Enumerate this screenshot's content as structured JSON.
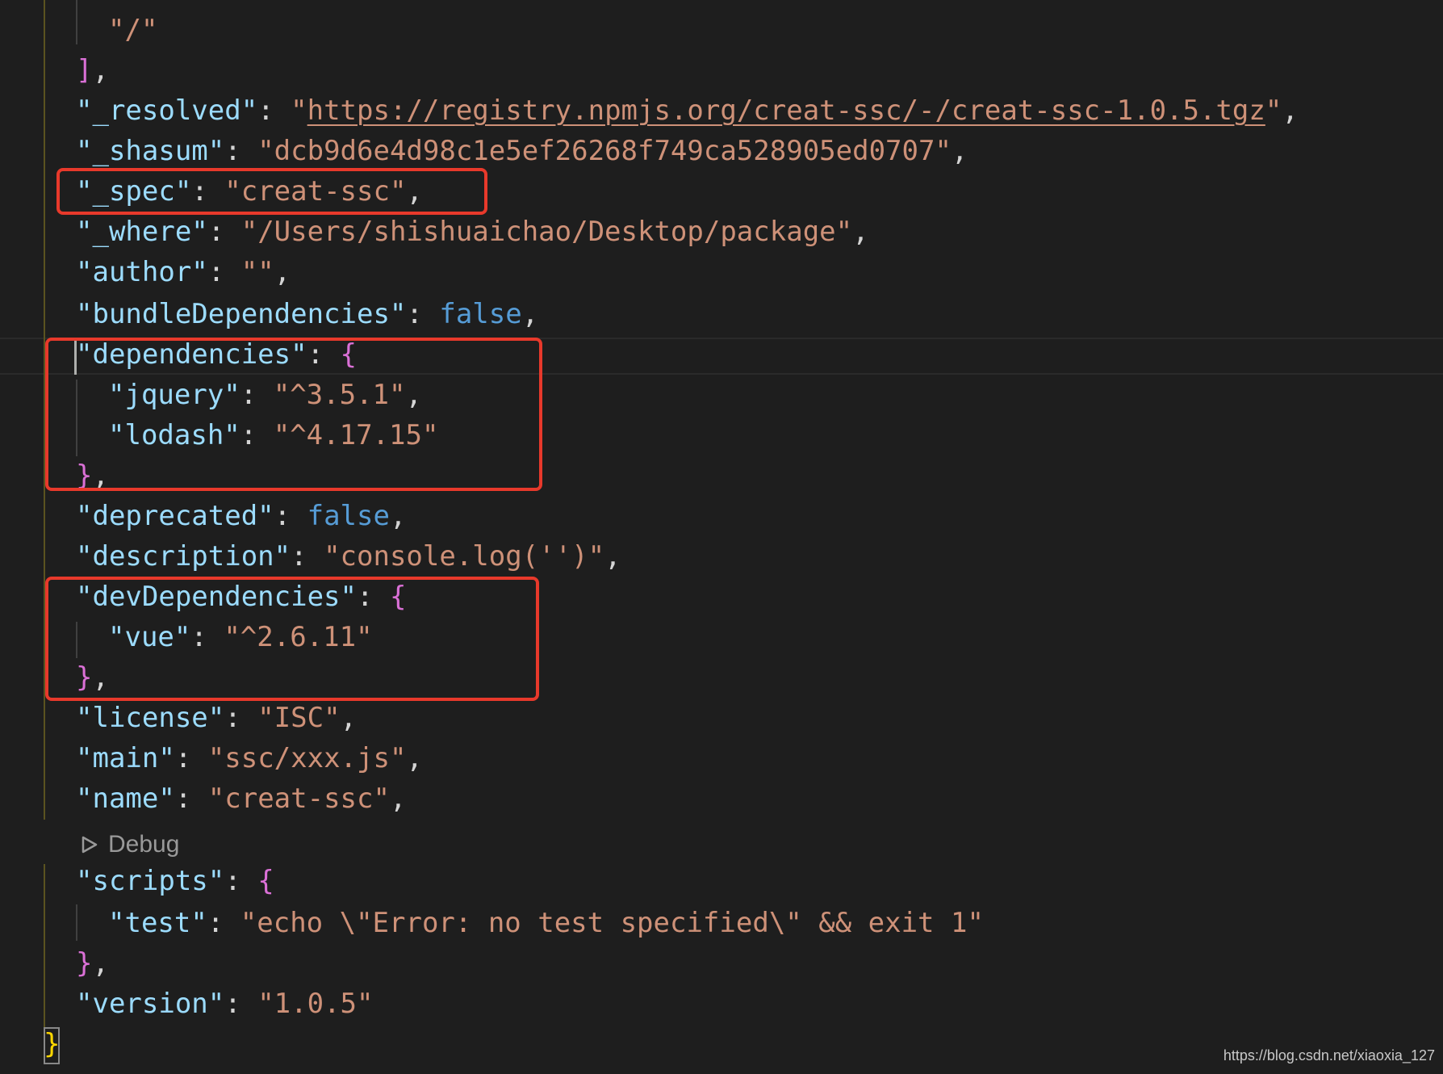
{
  "editor": {
    "lines": [
      {
        "indent": 1,
        "parts": [
          {
            "c": "s",
            "t": "\"/\""
          }
        ]
      },
      {
        "indent": 0,
        "parts": [
          {
            "c": "br",
            "t": "]"
          },
          {
            "c": "p",
            "t": ","
          }
        ]
      },
      {
        "indent": 0,
        "parts": [
          {
            "c": "k",
            "t": "\"_resolved\""
          },
          {
            "c": "p",
            "t": ": "
          },
          {
            "c": "s",
            "t": "\""
          },
          {
            "c": "url",
            "t": "https://registry.npmjs.org/creat-ssc/-/creat-ssc-1.0.5.tgz"
          },
          {
            "c": "s",
            "t": "\""
          },
          {
            "c": "p",
            "t": ","
          }
        ]
      },
      {
        "indent": 0,
        "parts": [
          {
            "c": "k",
            "t": "\"_shasum\""
          },
          {
            "c": "p",
            "t": ": "
          },
          {
            "c": "s",
            "t": "\"dcb9d6e4d98c1e5ef26268f749ca528905ed0707\""
          },
          {
            "c": "p",
            "t": ","
          }
        ]
      },
      {
        "indent": 0,
        "parts": [
          {
            "c": "k",
            "t": "\"_spec\""
          },
          {
            "c": "p",
            "t": ": "
          },
          {
            "c": "s",
            "t": "\"creat-ssc\""
          },
          {
            "c": "p",
            "t": ","
          }
        ]
      },
      {
        "indent": 0,
        "parts": [
          {
            "c": "k",
            "t": "\"_where\""
          },
          {
            "c": "p",
            "t": ": "
          },
          {
            "c": "s",
            "t": "\"/Users/shishuaichao/Desktop/package\""
          },
          {
            "c": "p",
            "t": ","
          }
        ]
      },
      {
        "indent": 0,
        "parts": [
          {
            "c": "k",
            "t": "\"author\""
          },
          {
            "c": "p",
            "t": ": "
          },
          {
            "c": "s",
            "t": "\"\""
          },
          {
            "c": "p",
            "t": ","
          }
        ]
      },
      {
        "indent": 0,
        "parts": [
          {
            "c": "k",
            "t": "\"bundleDependencies\""
          },
          {
            "c": "p",
            "t": ": "
          },
          {
            "c": "b",
            "t": "false"
          },
          {
            "c": "p",
            "t": ","
          }
        ]
      },
      {
        "indent": 0,
        "parts": [
          {
            "c": "k",
            "t": "\"dependencies\""
          },
          {
            "c": "p",
            "t": ": "
          },
          {
            "c": "br",
            "t": "{"
          }
        ]
      },
      {
        "indent": 1,
        "parts": [
          {
            "c": "k",
            "t": "\"jquery\""
          },
          {
            "c": "p",
            "t": ": "
          },
          {
            "c": "s",
            "t": "\"^3.5.1\""
          },
          {
            "c": "p",
            "t": ","
          }
        ]
      },
      {
        "indent": 1,
        "parts": [
          {
            "c": "k",
            "t": "\"lodash\""
          },
          {
            "c": "p",
            "t": ": "
          },
          {
            "c": "s",
            "t": "\"^4.17.15\""
          }
        ]
      },
      {
        "indent": 0,
        "parts": [
          {
            "c": "br",
            "t": "}"
          },
          {
            "c": "p",
            "t": ","
          }
        ]
      },
      {
        "indent": 0,
        "parts": [
          {
            "c": "k",
            "t": "\"deprecated\""
          },
          {
            "c": "p",
            "t": ": "
          },
          {
            "c": "b",
            "t": "false"
          },
          {
            "c": "p",
            "t": ","
          }
        ]
      },
      {
        "indent": 0,
        "parts": [
          {
            "c": "k",
            "t": "\"description\""
          },
          {
            "c": "p",
            "t": ": "
          },
          {
            "c": "s",
            "t": "\"console.log('')\""
          },
          {
            "c": "p",
            "t": ","
          }
        ]
      },
      {
        "indent": 0,
        "parts": [
          {
            "c": "k",
            "t": "\"devDependencies\""
          },
          {
            "c": "p",
            "t": ": "
          },
          {
            "c": "br",
            "t": "{"
          }
        ]
      },
      {
        "indent": 1,
        "parts": [
          {
            "c": "k",
            "t": "\"vue\""
          },
          {
            "c": "p",
            "t": ": "
          },
          {
            "c": "s",
            "t": "\"^2.6.11\""
          }
        ]
      },
      {
        "indent": 0,
        "parts": [
          {
            "c": "br",
            "t": "}"
          },
          {
            "c": "p",
            "t": ","
          }
        ]
      },
      {
        "indent": 0,
        "parts": [
          {
            "c": "k",
            "t": "\"license\""
          },
          {
            "c": "p",
            "t": ": "
          },
          {
            "c": "s",
            "t": "\"ISC\""
          },
          {
            "c": "p",
            "t": ","
          }
        ]
      },
      {
        "indent": 0,
        "parts": [
          {
            "c": "k",
            "t": "\"main\""
          },
          {
            "c": "p",
            "t": ": "
          },
          {
            "c": "s",
            "t": "\"ssc/xxx.js\""
          },
          {
            "c": "p",
            "t": ","
          }
        ]
      },
      {
        "indent": 0,
        "parts": [
          {
            "c": "k",
            "t": "\"name\""
          },
          {
            "c": "p",
            "t": ": "
          },
          {
            "c": "s",
            "t": "\"creat-ssc\""
          },
          {
            "c": "p",
            "t": ","
          }
        ]
      },
      {
        "indent": 0,
        "parts": [
          {
            "c": "k",
            "t": "\"scripts\""
          },
          {
            "c": "p",
            "t": ": "
          },
          {
            "c": "br",
            "t": "{"
          }
        ]
      },
      {
        "indent": 1,
        "parts": [
          {
            "c": "k",
            "t": "\"test\""
          },
          {
            "c": "p",
            "t": ": "
          },
          {
            "c": "s",
            "t": "\"echo \\\"Error: no test specified\\\" && exit 1\""
          }
        ]
      },
      {
        "indent": 0,
        "parts": [
          {
            "c": "br",
            "t": "}"
          },
          {
            "c": "p",
            "t": ","
          }
        ]
      },
      {
        "indent": 0,
        "parts": [
          {
            "c": "k",
            "t": "\"version\""
          },
          {
            "c": "p",
            "t": ": "
          },
          {
            "c": "s",
            "t": "\"1.0.5\""
          }
        ]
      },
      {
        "indent": -1,
        "parts": [
          {
            "c": "br0",
            "t": "}"
          }
        ]
      }
    ]
  },
  "codelens": {
    "debug_label": "Debug",
    "icon": "play-outline-icon"
  },
  "watermark": "https://blog.csdn.net/xiaoxia_127",
  "colors": {
    "background": "#1e1e1e",
    "property_key": "#9cdcfe",
    "string_value": "#ce9178",
    "boolean": "#569cd6",
    "bracket": "#da70d6",
    "outer_bracket": "#ffd700",
    "highlight_box": "#e8392b"
  }
}
